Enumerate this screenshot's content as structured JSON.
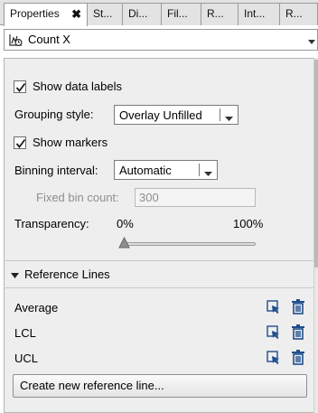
{
  "tabs": [
    {
      "label": "Properties",
      "active": true
    },
    {
      "label": "St..."
    },
    {
      "label": "Di..."
    },
    {
      "label": "Fil..."
    },
    {
      "label": "R..."
    },
    {
      "label": "Int..."
    },
    {
      "label": "R..."
    }
  ],
  "tab_close_glyph": "✖",
  "data_role": {
    "value": "Count X",
    "icon": "histogram-icon"
  },
  "options": {
    "show_data_labels": {
      "label": "Show data labels",
      "checked": true
    },
    "grouping_style": {
      "label": "Grouping style:",
      "value": "Overlay Unfilled"
    },
    "show_markers": {
      "label": "Show markers",
      "checked": true
    },
    "binning_interval": {
      "label": "Binning interval:",
      "value": "Automatic"
    },
    "fixed_bin_count": {
      "label": "Fixed bin count:",
      "value": "300",
      "disabled": true
    },
    "transparency": {
      "label": "Transparency:",
      "min_label": "0%",
      "max_label": "100%",
      "value": 0
    }
  },
  "reference_lines": {
    "title": "Reference Lines",
    "expanded": true,
    "items": [
      {
        "label": "Average"
      },
      {
        "label": "LCL"
      },
      {
        "label": "UCL"
      }
    ],
    "create_button": "Create new reference line..."
  },
  "colors": {
    "accent_icon": "#1f4e8c",
    "panel_bg": "#eeeeee",
    "tab_bg": "#e3e3e3"
  }
}
